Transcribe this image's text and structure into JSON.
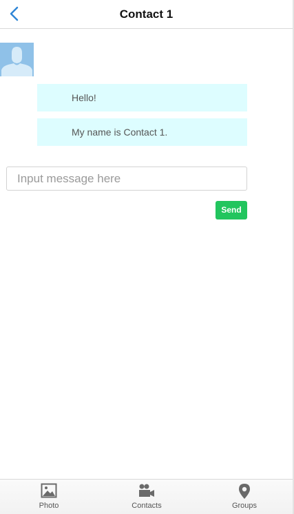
{
  "header": {
    "title": "Contact 1",
    "back_icon": "chevron-left-icon"
  },
  "colors": {
    "accent": "#2f86d6",
    "bubble": "#ddfdff",
    "send": "#22c55e",
    "avatar": "#8fc1e8"
  },
  "chat": {
    "avatar_icon": "person-avatar-icon",
    "messages": [
      {
        "text": "Hello!"
      },
      {
        "text": "My name is Contact 1."
      }
    ]
  },
  "composer": {
    "value": "",
    "placeholder": "Input message here",
    "send_label": "Send"
  },
  "tabbar": {
    "tabs": [
      {
        "label": "Photo",
        "icon": "photo-icon"
      },
      {
        "label": "Contacts",
        "icon": "video-camera-icon"
      },
      {
        "label": "Groups",
        "icon": "map-pin-icon"
      }
    ]
  }
}
